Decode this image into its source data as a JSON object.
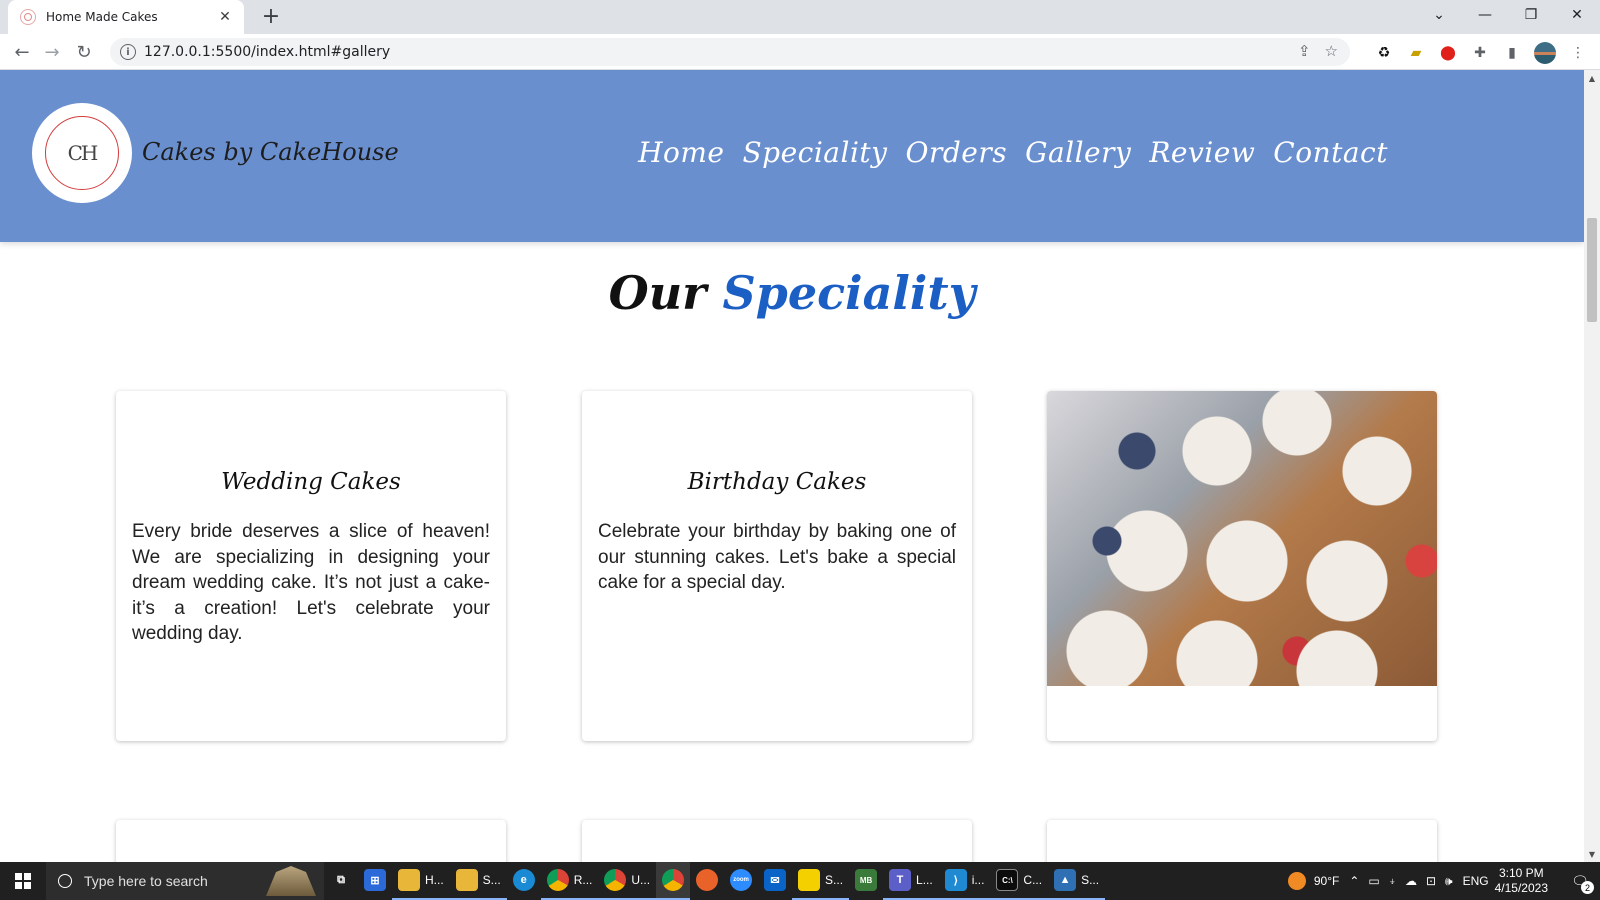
{
  "browser": {
    "tab_title": "Home Made Cakes",
    "new_tab_label": "+",
    "url": "127.0.0.1:5500/index.html#gallery"
  },
  "site": {
    "logo_initials": "CH",
    "brand_name": "Cakes by CakeHouse",
    "nav": [
      "Home",
      "Speciality",
      "Orders",
      "Gallery",
      "Review",
      "Contact"
    ]
  },
  "section": {
    "title_part1": "Our",
    "title_part2": "Speciality"
  },
  "cards": [
    {
      "title": "Wedding Cakes",
      "text": "Every bride deserves a slice of heaven! We are specializing in designing your dream wedding cake. It’s not just a cake-it’s a creation! Let's celebrate your wedding day."
    },
    {
      "title": "Birthday Cakes",
      "text": "Celebrate your birthday by baking one of our stunning cakes. Let's bake a special cake for a special day."
    }
  ],
  "taskbar": {
    "search_placeholder": "Type here to search",
    "items": [
      {
        "label": "H...",
        "icon": "folder-icon"
      },
      {
        "label": "S...",
        "icon": "folder-icon"
      },
      {
        "label": "",
        "icon": "edge-icon"
      },
      {
        "label": "R...",
        "icon": "chrome-icon"
      },
      {
        "label": "U...",
        "icon": "chrome-icon"
      },
      {
        "label": "",
        "icon": "chrome-icon"
      },
      {
        "label": "",
        "icon": "firefox-icon"
      },
      {
        "label": "",
        "icon": "zoom-icon"
      },
      {
        "label": "",
        "icon": "mail-icon"
      },
      {
        "label": "S...",
        "icon": "sticky-notes-icon"
      },
      {
        "label": "",
        "icon": "app-icon"
      },
      {
        "label": "L...",
        "icon": "teams-icon"
      },
      {
        "label": "i...",
        "icon": "vscode-icon"
      },
      {
        "label": "C...",
        "icon": "terminal-icon"
      },
      {
        "label": "S...",
        "icon": "photos-icon"
      }
    ],
    "weather": "90°F",
    "language": "ENG",
    "time": "3:10 PM",
    "date": "4/15/2023",
    "notification_count": "2"
  },
  "colors": {
    "header_bg": "#6a8fcf",
    "accent_blue": "#1b5fc4"
  }
}
